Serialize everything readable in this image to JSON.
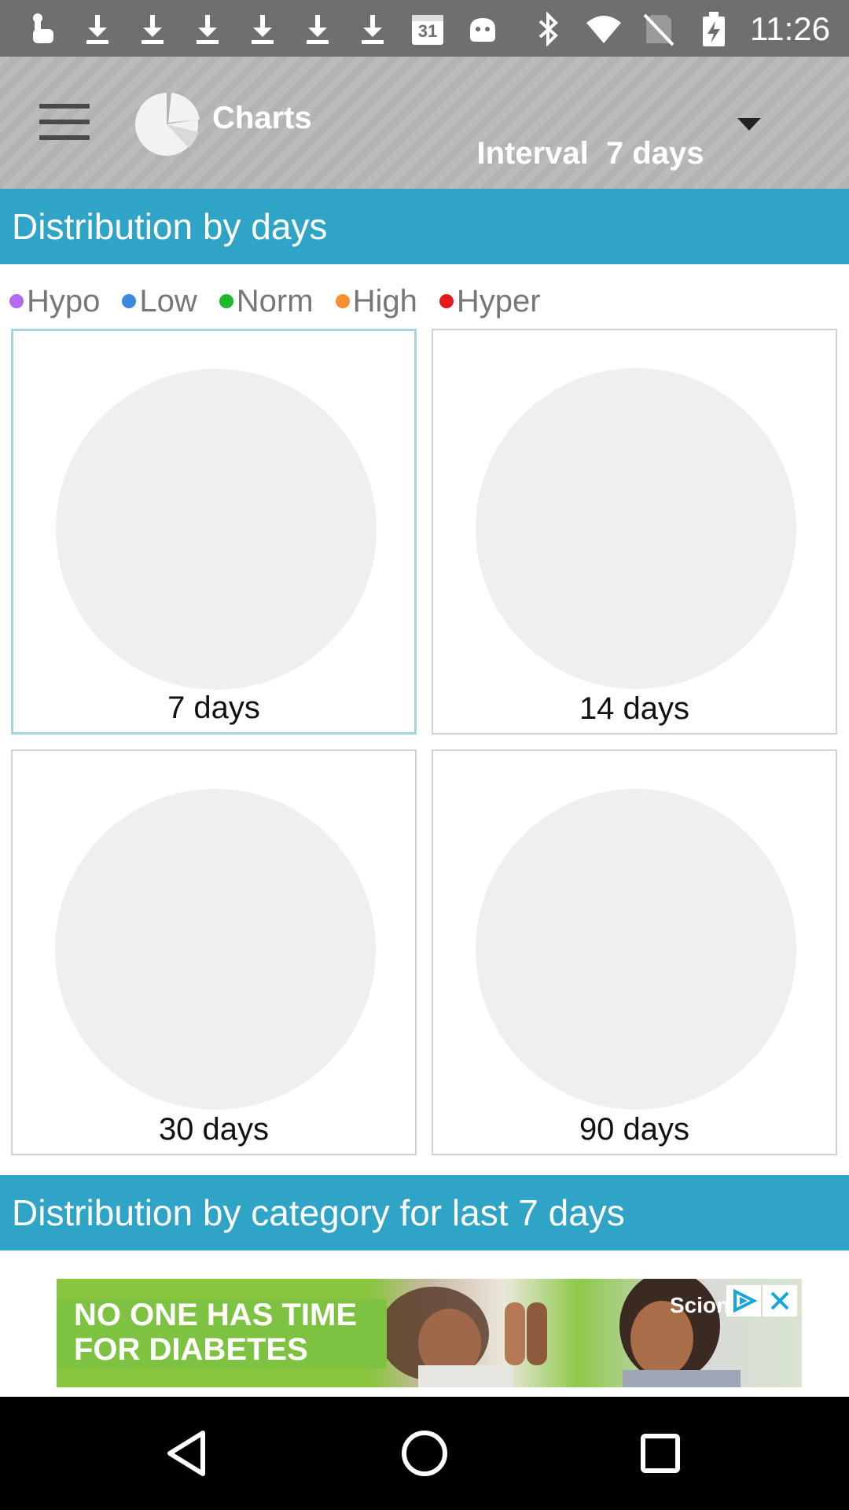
{
  "status_bar": {
    "time": "11:26",
    "calendar_day": "31",
    "left_icons": [
      "touch-icon",
      "download-icon",
      "download-icon",
      "download-icon",
      "download-icon",
      "download-icon",
      "download-icon",
      "calendar-icon",
      "android-icon"
    ],
    "right_icons": [
      "bluetooth-icon",
      "wifi-icon",
      "no-sim-icon",
      "battery-charging-icon"
    ]
  },
  "toolbar": {
    "title": "Charts",
    "interval_label": "Interval",
    "interval_value": "7 days"
  },
  "sections": {
    "by_days": "Distribution by days",
    "by_category": "Distribution by category for last 7 days"
  },
  "legend": [
    {
      "label": "Hypo",
      "color": "#b36bf0"
    },
    {
      "label": "Low",
      "color": "#3f86e0"
    },
    {
      "label": "Norm",
      "color": "#1fb82b"
    },
    {
      "label": "High",
      "color": "#f78e30"
    },
    {
      "label": "Hyper",
      "color": "#e21b1b"
    }
  ],
  "chart_data": [
    {
      "type": "pie",
      "title": "7 days",
      "selected": true,
      "values": []
    },
    {
      "type": "pie",
      "title": "14 days",
      "selected": false,
      "values": []
    },
    {
      "type": "pie",
      "title": "30 days",
      "selected": false,
      "values": []
    },
    {
      "type": "pie",
      "title": "90 days",
      "selected": false,
      "values": []
    }
  ],
  "ad": {
    "line1": "NO ONE HAS TIME",
    "line2": "FOR DIABETES",
    "brand": "Scion"
  },
  "colors": {
    "accent": "#2fa4c6",
    "toolbar": "#b3b3b3",
    "pie_empty": "#efefef",
    "selected_border": "#a8d2dc"
  }
}
